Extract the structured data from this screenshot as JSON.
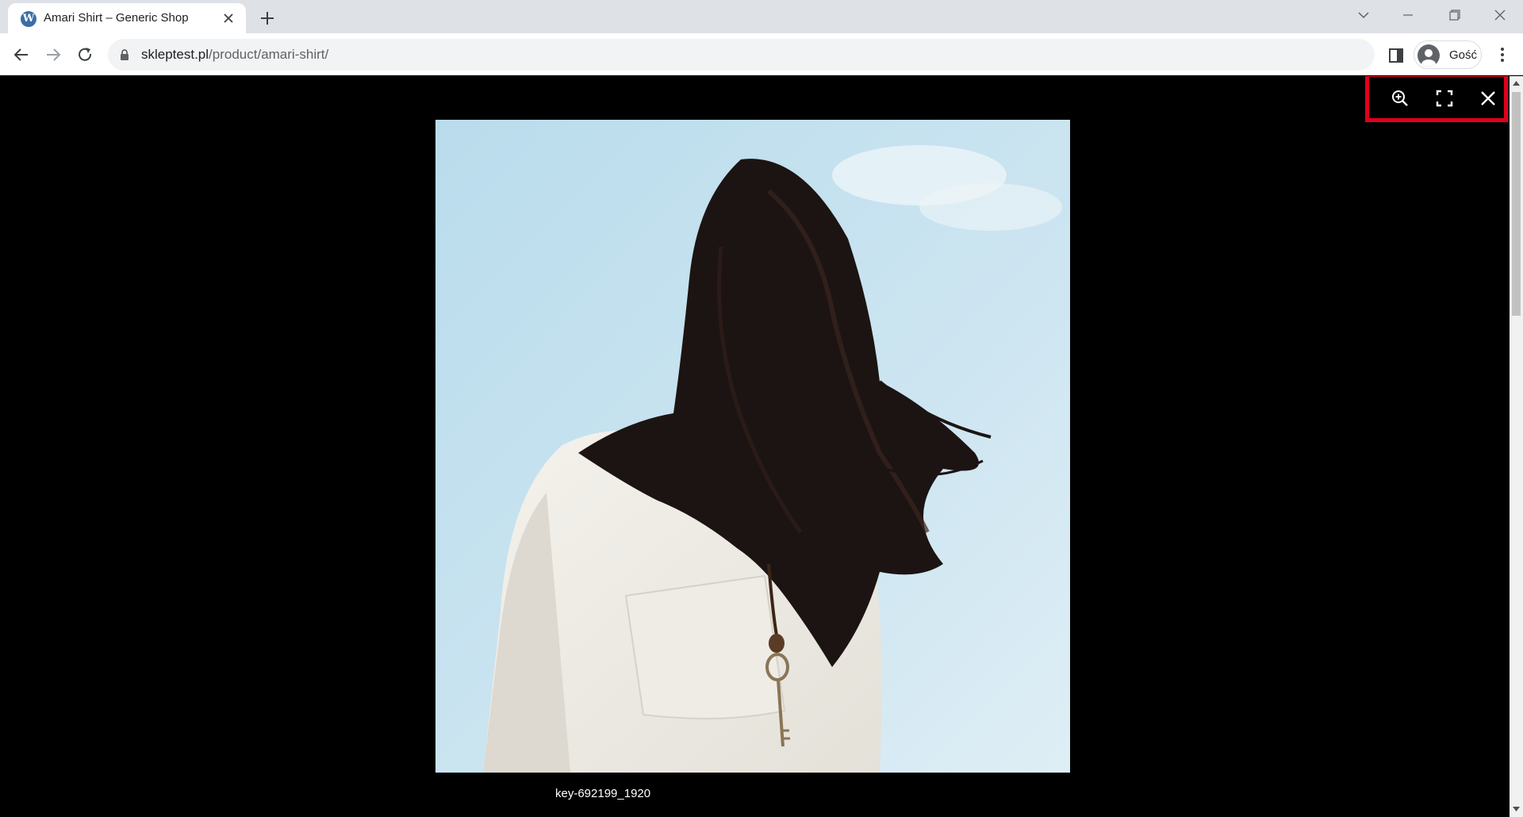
{
  "browser": {
    "tab": {
      "title": "Amari Shirt – Generic Shop",
      "favicon": "wordpress-icon",
      "favicon_glyph": "W"
    },
    "window_controls": [
      "tab-search-icon",
      "minimize-icon",
      "restore-icon",
      "close-icon"
    ],
    "url": {
      "host": "skleptest.pl",
      "path": "/product/amari-shirt/"
    },
    "profile": {
      "label": "Gość",
      "icon": "person-icon"
    },
    "icons": [
      "back-arrow-icon",
      "forward-arrow-icon",
      "reload-icon",
      "lock-icon",
      "side-panel-icon",
      "more-menu-icon"
    ]
  },
  "lightbox": {
    "buttons": [
      {
        "name": "zoom-in-button",
        "icon": "zoom-in-icon"
      },
      {
        "name": "fullscreen-button",
        "icon": "fullscreen-icon"
      },
      {
        "name": "close-lightbox-button",
        "icon": "close-icon"
      }
    ],
    "highlight_color": "#e0001b",
    "image": {
      "subject": "woman-with-long-dark-hair-white-shirt-key-necklace",
      "sky_color": "#c6e0ef"
    },
    "caption": "key-692199_1920"
  },
  "colors": {
    "tabstrip": "#dee1e6",
    "omnibox": "#f1f3f4",
    "lightbox_bg": "#000000"
  }
}
